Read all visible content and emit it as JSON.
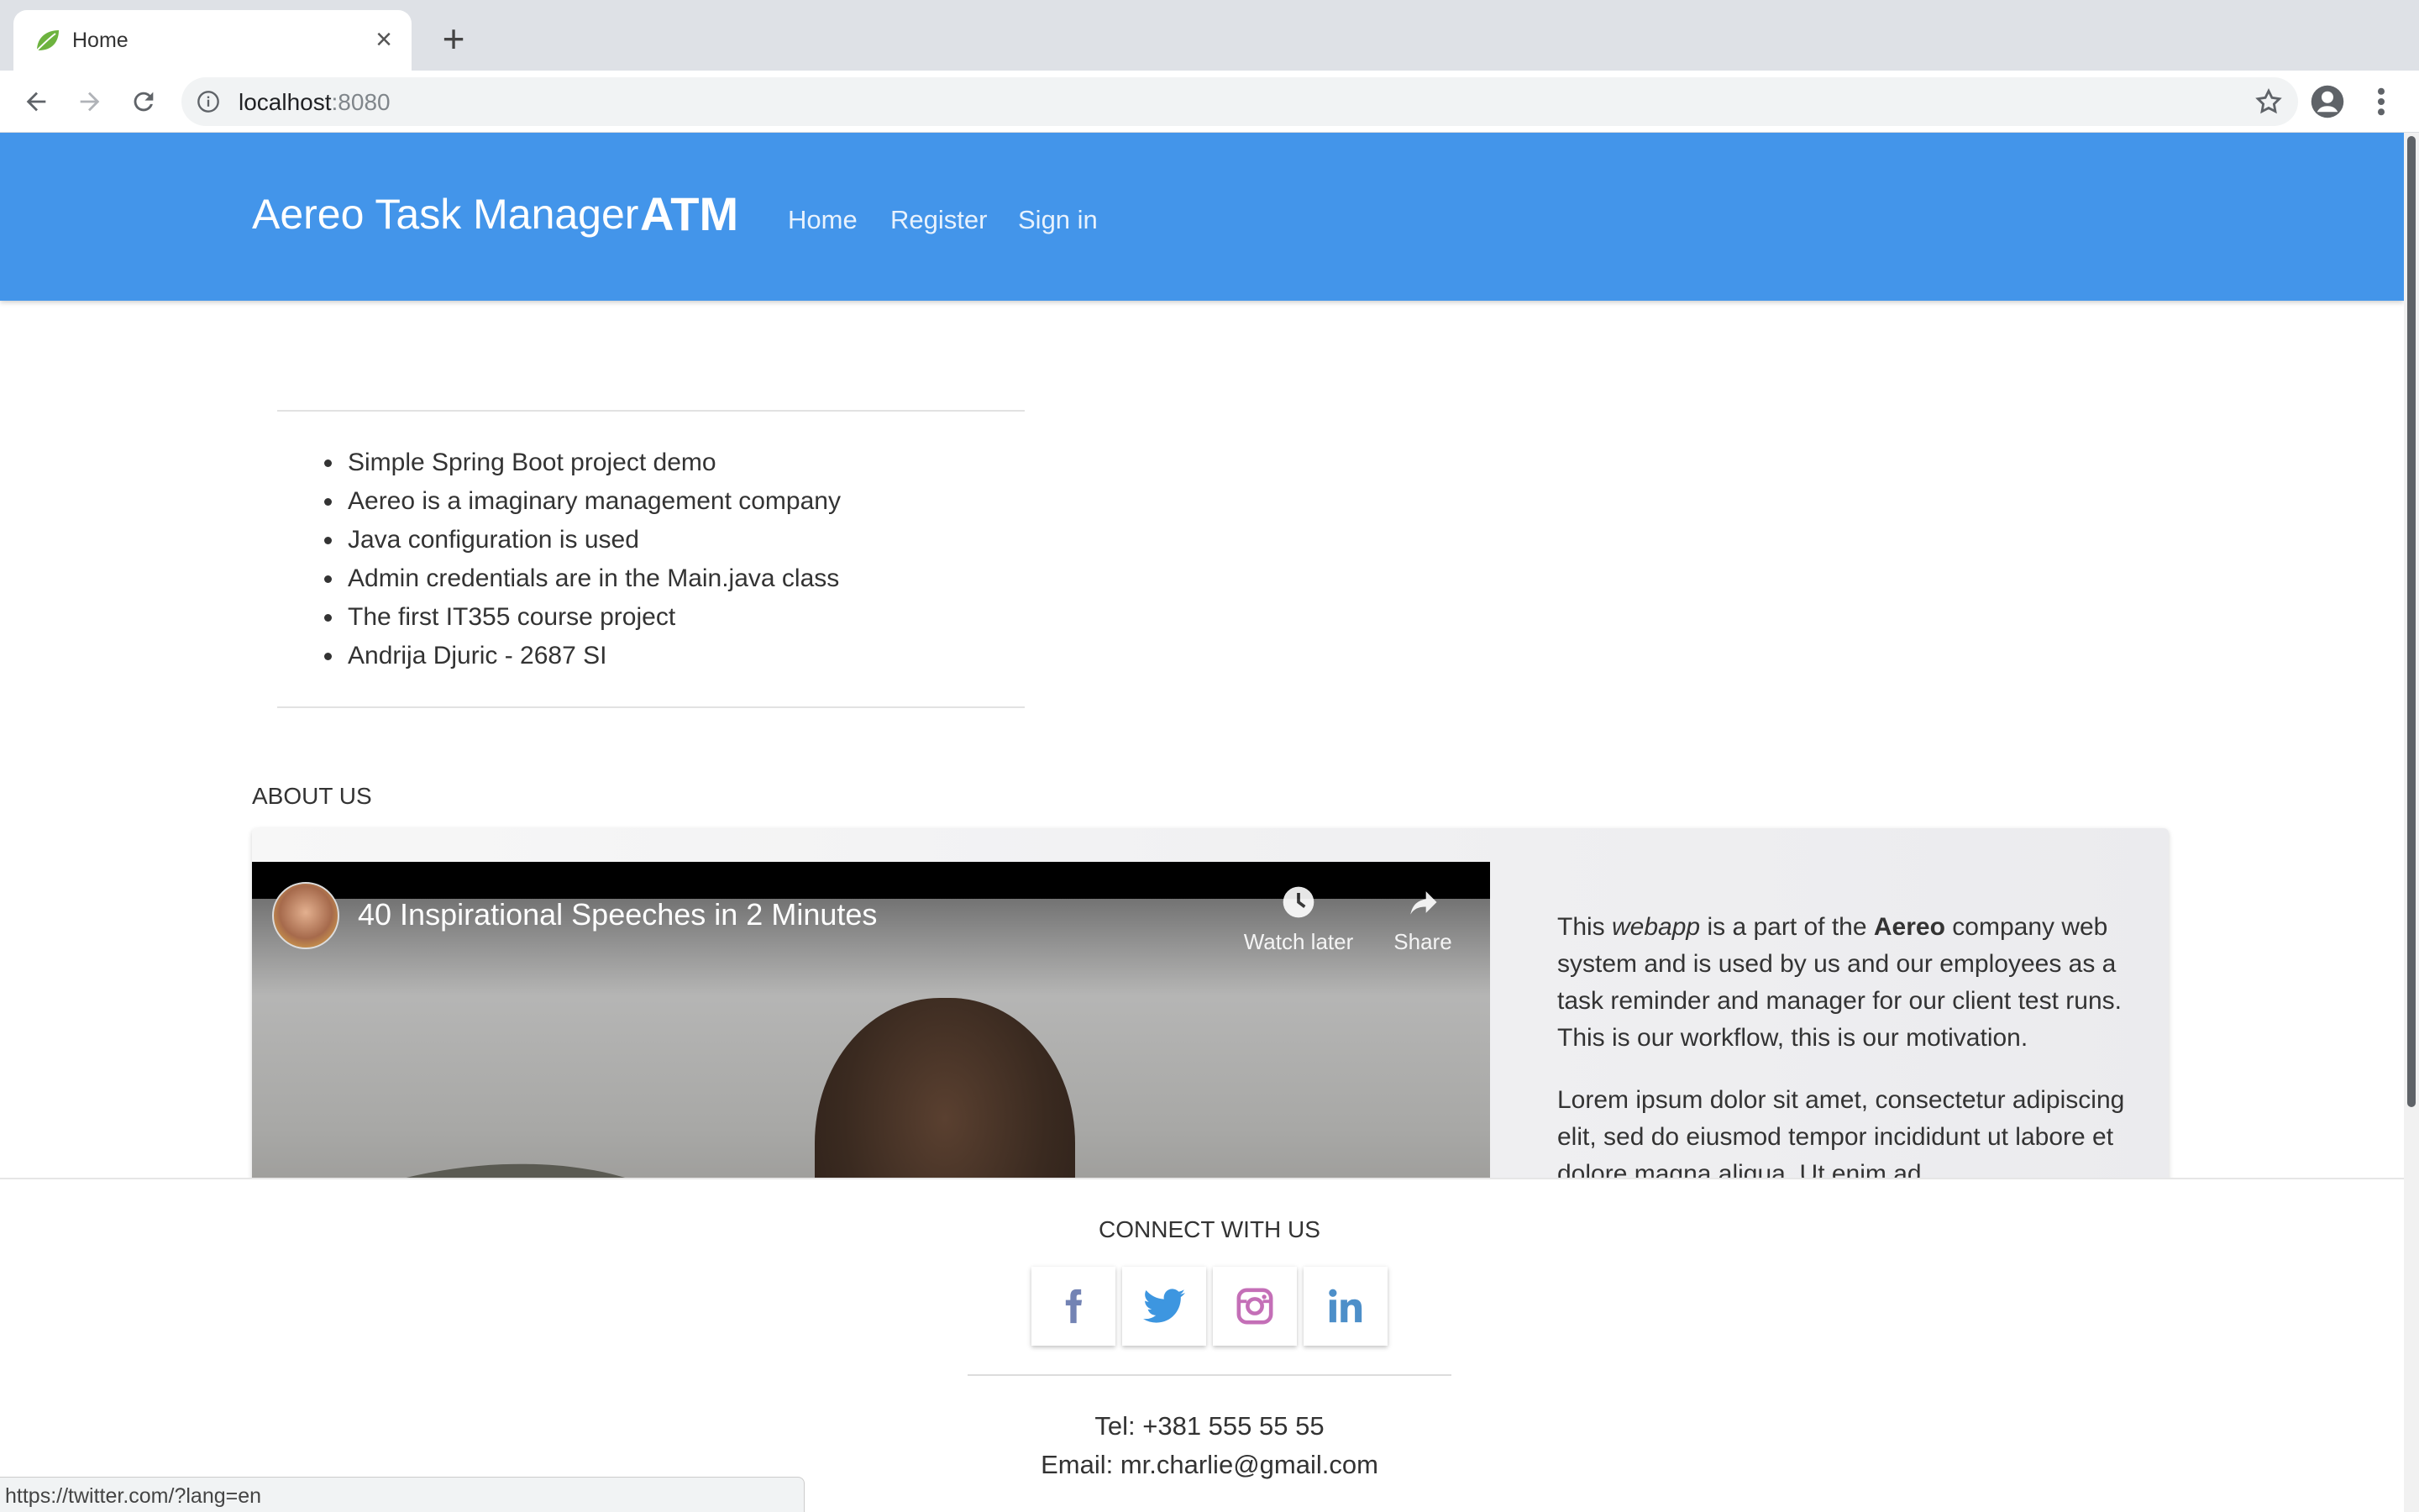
{
  "browser": {
    "tab_title": "Home",
    "new_tab_symbol": "+",
    "close_symbol": "×",
    "url_host": "localhost",
    "url_port": ":8080",
    "status_url": "https://twitter.com/?lang=en"
  },
  "header": {
    "brand": "Aereo Task Manager",
    "brand_abbr": "ATM",
    "nav": [
      "Home",
      "Register",
      "Sign in"
    ],
    "color": "#4395ea"
  },
  "features": [
    "Simple Spring Boot project demo",
    "Aereo is a imaginary management company",
    "Java configuration is used",
    "Admin credentials are in the Main.java class",
    "The first IT355 course project",
    "Andrija Djuric - 2687 SI"
  ],
  "about": {
    "heading": "ABOUT US",
    "video": {
      "title": "40 Inspirational Speeches in 2 Minutes",
      "watch_later": "Watch later",
      "share": "Share"
    },
    "p1_before": "This ",
    "p1_em": "webapp",
    "p1_mid": " is a part of the ",
    "p1_strong": "Aereo",
    "p1_after": " company web system and is used by us and our employees as a task reminder and manager for our client test runs. This is our workflow, this is our motivation.",
    "p2": "Lorem ipsum dolor sit amet, consectetur adipiscing elit, sed do eiusmod tempor incididunt ut labore et dolore magna aliqua. Ut enim ad"
  },
  "footer": {
    "connect": "CONNECT WITH US",
    "social": [
      "facebook-icon",
      "twitter-icon",
      "instagram-icon",
      "linkedin-icon"
    ],
    "tel": "Tel: +381 555 55 55",
    "email": "Email: mr.charlie@gmail.com"
  }
}
